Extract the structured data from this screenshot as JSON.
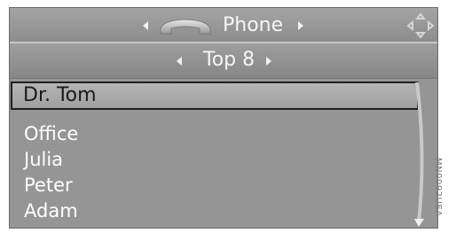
{
  "header": {
    "title": "Phone",
    "icon": "handset-icon"
  },
  "subheader": {
    "title": "Top 8"
  },
  "list": {
    "selected": "Dr. Tom",
    "items": [
      "Office",
      "Julia",
      "Peter",
      "Adam"
    ]
  },
  "side_code": "MN0092UEA",
  "colors": {
    "screen_background": "#929292",
    "text": "#ffffff",
    "selection_border": "#1f1f1f"
  }
}
